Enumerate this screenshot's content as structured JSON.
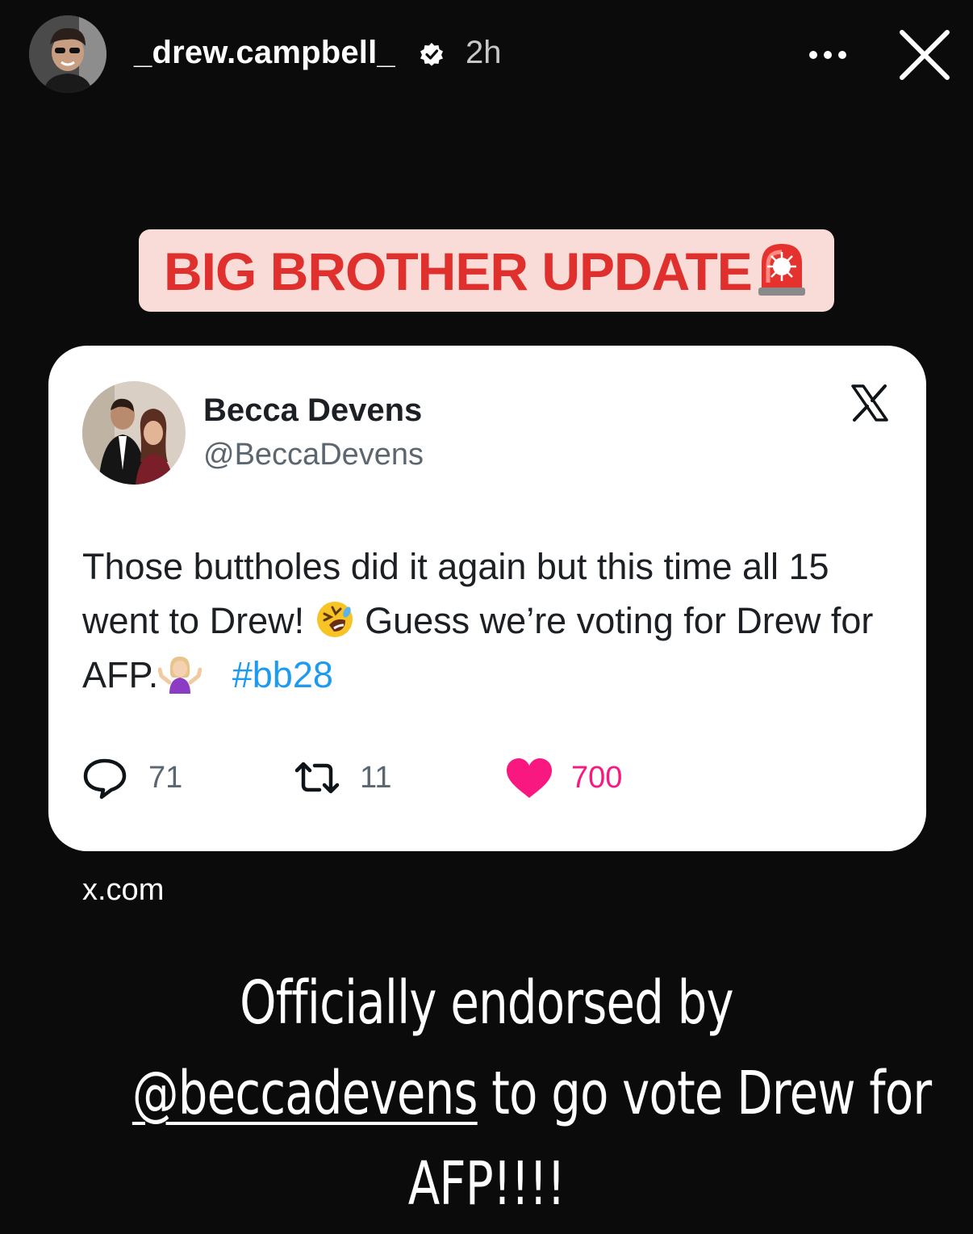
{
  "story": {
    "username": "_drew.campbell_",
    "age": "2h",
    "verified": true
  },
  "banner": {
    "text": "BIG BROTHER UPDATE",
    "text_color": "#e0302d",
    "background": "#f9dcd7",
    "icon": "police-siren-icon"
  },
  "tweet": {
    "name": "Becca Devens",
    "handle": "@BeccaDevens",
    "text_part1": "Those buttholes did it again but this time all 15 went to Drew! ",
    "text_part2": " Guess we’re voting for Drew for AFP.",
    "hashtag": "#bb28",
    "emoji_1": "rolling-on-floor-laughing-icon",
    "emoji_2": "woman-shrugging-icon",
    "replies": "71",
    "retweets": "11",
    "likes": "700",
    "platform_icon": "x-logo-icon"
  },
  "source": "x.com",
  "caption": {
    "line1": "Officially endorsed by",
    "mention": "@beccadevens",
    "line2_rest": " to go vote Drew for",
    "line3": "AFP!!!!"
  },
  "colors": {
    "background": "#0b0b0b",
    "hashtag": "#1d9bf0",
    "like": "#f91880"
  }
}
